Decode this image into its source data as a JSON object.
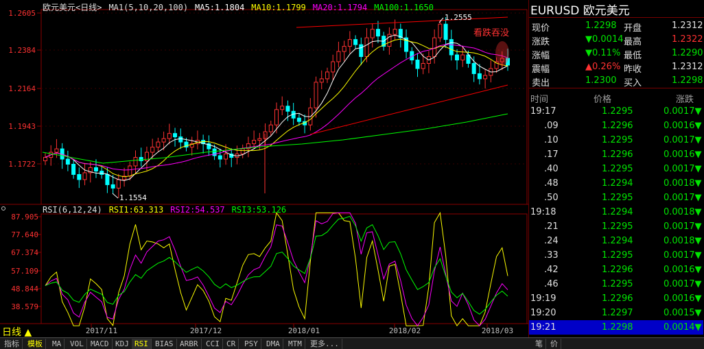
{
  "chart_header": {
    "title": "欧元美元<日线>",
    "ma_params": "MA1(5,10,20,100)",
    "ma5": "MA5:1.1804",
    "ma10": "MA10:1.1799",
    "ma20": "MA20:1.1794",
    "ma100": "MA100:1.1650"
  },
  "price_axis": [
    "1.2605",
    "1.2384",
    "1.2164",
    "1.1943",
    "1.1722"
  ],
  "price_annotations": {
    "high": "1.2555",
    "low": "1.1554",
    "bearish_tag": "看跌吞没"
  },
  "rsi_header": {
    "params": "RSI(6,12,24)",
    "rsi1": "RSI1:63.313",
    "rsi2": "RSI2:54.537",
    "rsi3": "RSI3:53.126"
  },
  "rsi_axis": [
    "87.905",
    "77.640",
    "67.374",
    "57.109",
    "48.844",
    "38.579"
  ],
  "date_axis": [
    "2017/11",
    "2017/12",
    "2018/01",
    "2018/02",
    "2018/03"
  ],
  "period_label": "日线",
  "period_arrow": "▲",
  "bottom_tabs": [
    "指标",
    "模板",
    "MA",
    "VOL",
    "MACD",
    "KDJ",
    "RSI",
    "BIAS",
    "ARBR",
    "CCI",
    "CR",
    "PSY",
    "DMA",
    "MTM",
    "更多..."
  ],
  "active_tab": "RSI",
  "panel": {
    "symbol": "EURUSD",
    "name": "欧元美元",
    "quotes": [
      {
        "l1": "现价",
        "v1": "1.2298",
        "c1": "green",
        "l2": "开盘",
        "v2": "1.2312",
        "c2": "white"
      },
      {
        "l1": "涨跌",
        "v1": "▼0.0014",
        "c1": "green",
        "l2": "最高",
        "v2": "1.2322",
        "c2": "red"
      },
      {
        "l1": "涨幅",
        "v1": "▼0.11%",
        "c1": "green",
        "l2": "最低",
        "v2": "1.2290",
        "c2": "green"
      },
      {
        "l1": "震幅",
        "v1": "▲0.26%",
        "c1": "red",
        "l2": "昨收",
        "v2": "1.2312",
        "c2": "white"
      },
      {
        "l1": "卖出",
        "v1": "1.2300",
        "c1": "green",
        "l2": "买入",
        "v2": "1.2298",
        "c2": "green"
      }
    ],
    "tick_headers": [
      "时间",
      "价格",
      "涨跌"
    ],
    "ticks": [
      {
        "t": "19:17",
        "p": "1.2295",
        "c": "0.0017▼"
      },
      {
        "t": ".09",
        "p": "1.2296",
        "c": "0.0016▼"
      },
      {
        "t": ".10",
        "p": "1.2295",
        "c": "0.0017▼"
      },
      {
        "t": ".17",
        "p": "1.2296",
        "c": "0.0016▼"
      },
      {
        "t": ".40",
        "p": "1.2295",
        "c": "0.0017▼"
      },
      {
        "t": ".48",
        "p": "1.2294",
        "c": "0.0018▼"
      },
      {
        "t": ".50",
        "p": "1.2295",
        "c": "0.0017▼"
      },
      {
        "t": "19:18",
        "p": "1.2294",
        "c": "0.0018▼"
      },
      {
        "t": ".21",
        "p": "1.2295",
        "c": "0.0017▼"
      },
      {
        "t": ".24",
        "p": "1.2294",
        "c": "0.0018▼"
      },
      {
        "t": ".33",
        "p": "1.2295",
        "c": "0.0017▼"
      },
      {
        "t": ".42",
        "p": "1.2296",
        "c": "0.0016▼"
      },
      {
        "t": ".46",
        "p": "1.2295",
        "c": "0.0017▼"
      },
      {
        "t": "19:19",
        "p": "1.2296",
        "c": "0.0016▼"
      },
      {
        "t": "19:20",
        "p": "1.2297",
        "c": "0.0015▼"
      },
      {
        "t": "19:21",
        "p": "1.2298",
        "c": "0.0014▼"
      }
    ],
    "bottom_tabs": [
      "笔",
      "价"
    ]
  },
  "colors": {
    "up": "#ff3232",
    "down": "#00ffff",
    "ma5": "#ffffff",
    "ma10": "#ffff00",
    "ma20": "#ff00ff",
    "ma100": "#00ff00",
    "trend": "#ff0000",
    "selected_row": "#0000c8"
  }
}
